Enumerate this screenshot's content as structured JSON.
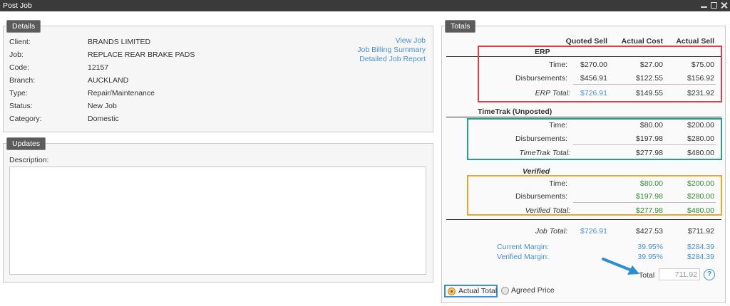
{
  "window": {
    "title": "Post Job"
  },
  "details": {
    "tab": "Details",
    "rows": [
      {
        "label": "Client:",
        "value": "BRANDS LIMITED"
      },
      {
        "label": "Job:",
        "value": "REPLACE REAR BRAKE PADS"
      },
      {
        "label": "Code:",
        "value": "12157"
      },
      {
        "label": "Branch:",
        "value": "AUCKLAND"
      },
      {
        "label": "Type:",
        "value": "Repair/Maintenance"
      },
      {
        "label": "Status:",
        "value": "New Job"
      },
      {
        "label": "Category:",
        "value": "Domestic"
      }
    ],
    "links": [
      "View Job",
      "Job Billing Summary",
      "Detailed Job Report"
    ]
  },
  "updates": {
    "tab": "Updates",
    "description_label": "Description:",
    "description_value": ""
  },
  "totals": {
    "tab": "Totals",
    "columns": [
      "Quoted Sell",
      "Actual Cost",
      "Actual Sell"
    ],
    "erp": {
      "title": "ERP",
      "time": {
        "label": "Time:",
        "quoted": "$270.00",
        "cost": "$27.00",
        "sell": "$75.00"
      },
      "disb": {
        "label": "Disbursements:",
        "quoted": "$456.91",
        "cost": "$122.55",
        "sell": "$156.92"
      },
      "total": {
        "label": "ERP Total:",
        "quoted": "$726.91",
        "cost": "$149.55",
        "sell": "$231.92"
      }
    },
    "timetrak": {
      "title": "TimeTrak (Unposted)",
      "time": {
        "label": "Time:",
        "cost": "$80.00",
        "sell": "$200.00"
      },
      "disb": {
        "label": "Disbursements:",
        "cost": "$197.98",
        "sell": "$280.00"
      },
      "total": {
        "label": "TimeTrak Total:",
        "cost": "$277.98",
        "sell": "$480.00"
      }
    },
    "verified": {
      "title": "Verified",
      "time": {
        "label": "Time:",
        "cost": "$80.00",
        "sell": "$200.00"
      },
      "disb": {
        "label": "Disbursements:",
        "cost": "$197.98",
        "sell": "$280.00"
      },
      "total": {
        "label": "Verified Total:",
        "cost": "$277.98",
        "sell": "$480.00"
      }
    },
    "job_total": {
      "label": "Job Total:",
      "quoted": "$726.91",
      "cost": "$427.53",
      "sell": "$711.92"
    },
    "current_margin": {
      "label": "Current Margin:",
      "pct": "39.95%",
      "amount": "$284.39"
    },
    "verified_margin": {
      "label": "Verified Margin:",
      "pct": "39.95%",
      "amount": "$284.39"
    },
    "total_label": "Total",
    "total_value": "711.92",
    "help_glyph": "?",
    "radio": {
      "actual": "Actual Total",
      "agreed": "Agreed Price",
      "selected": "actual"
    }
  },
  "colors": {
    "erp_box": "#e0404a",
    "timetrak_box": "#2a9d8f",
    "verified_box": "#e8a82f",
    "radio_focus": "#3a8fd6",
    "arrow": "#2a8fd0",
    "link": "#4a90d9",
    "green": "#2e8b2e"
  },
  "icons": [
    "restore-icon",
    "maximize-icon",
    "close-icon",
    "help-icon",
    "pointer-arrow-icon"
  ]
}
